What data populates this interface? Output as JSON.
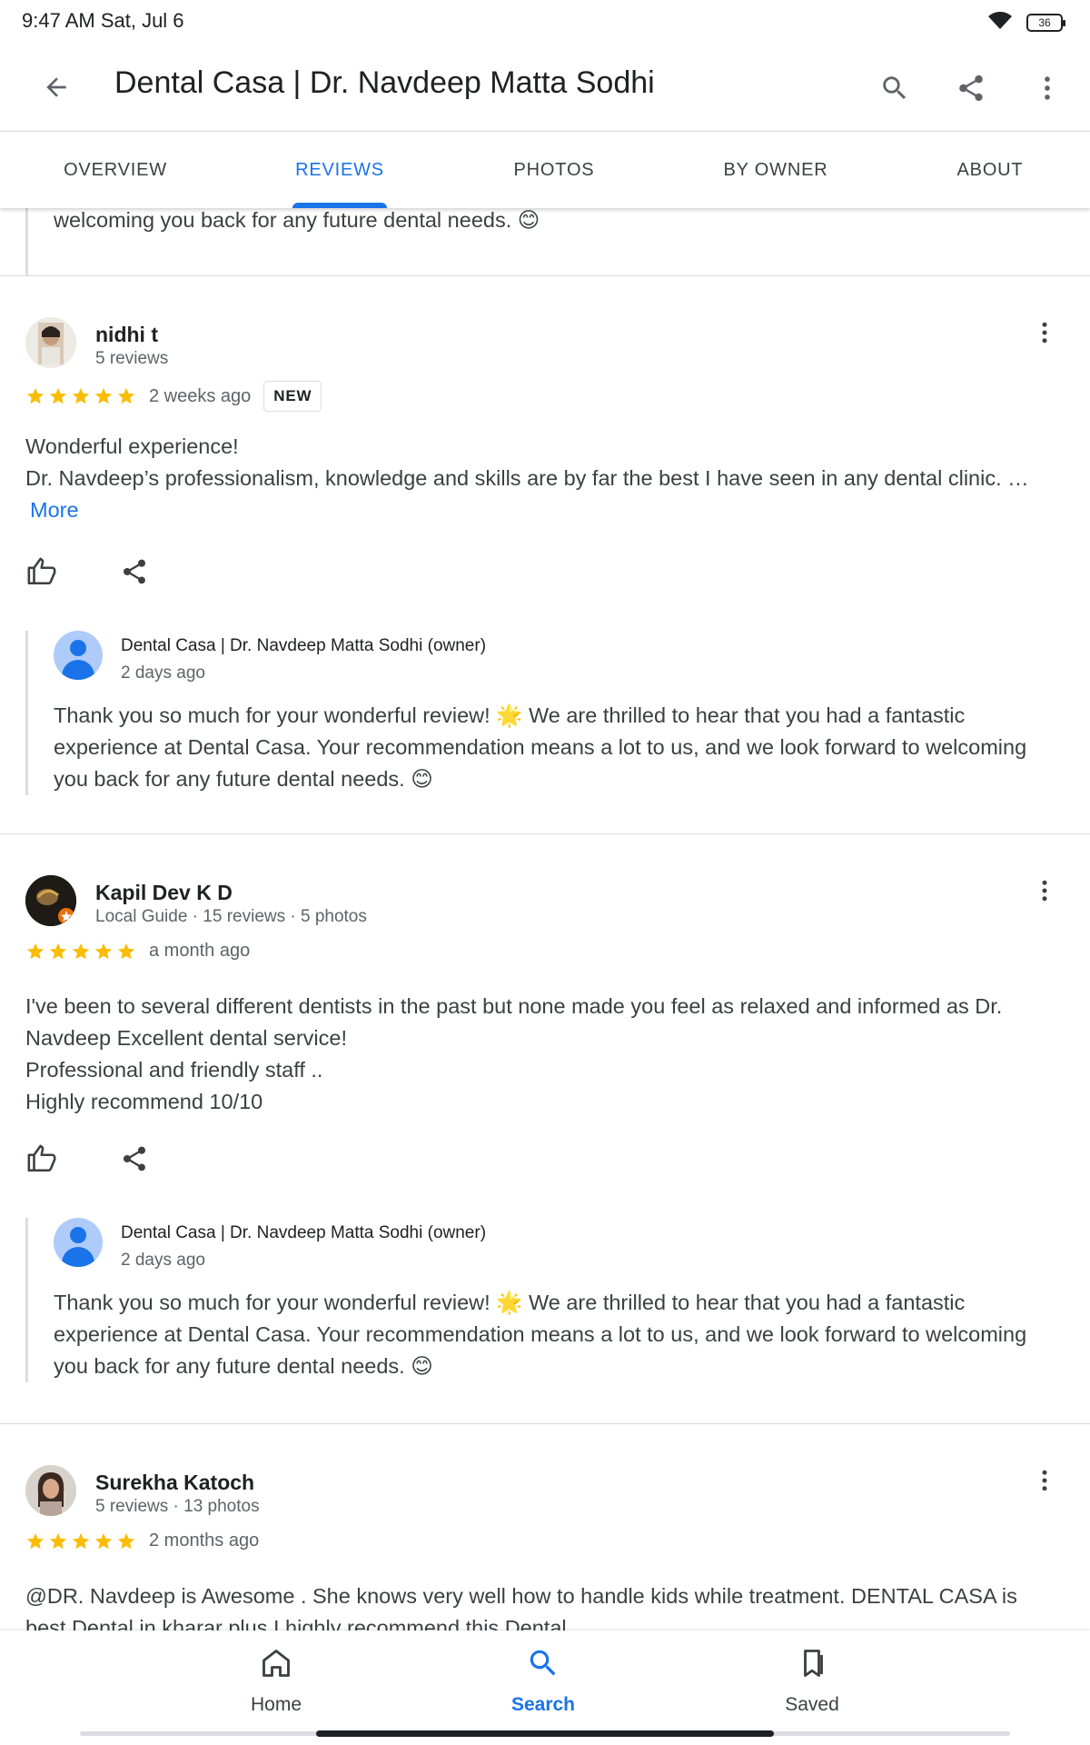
{
  "status_bar": {
    "time": "9:47 AM Sat, Jul 6",
    "battery": "36"
  },
  "app_bar": {
    "title": "Dental Casa | Dr. Navdeep Matta Sodhi"
  },
  "tabs": [
    {
      "label": "OVERVIEW"
    },
    {
      "label": "REVIEWS"
    },
    {
      "label": "PHOTOS"
    },
    {
      "label": "BY OWNER"
    },
    {
      "label": "ABOUT"
    }
  ],
  "active_tab": "REVIEWS",
  "partial_reply": {
    "text": "welcoming you back for any future dental needs. 😊"
  },
  "reviews": [
    {
      "name": "nidhi t",
      "meta": "5 reviews",
      "rating": 5,
      "time": "2 weeks ago",
      "badge": "NEW",
      "text_lines": [
        "Wonderful experience!",
        "Dr. Navdeep’s professionalism, knowledge and skills are by far the best I have seen in any dental clinic. …"
      ],
      "more_label": "More",
      "owner_reply": {
        "name": "Dental Casa | Dr. Navdeep Matta Sodhi (owner)",
        "time": "2 days ago",
        "text": "Thank you so much for your wonderful review! 🌟 We are thrilled to hear that you had a fantastic experience at Dental Casa. Your recommendation means a lot to us, and we look forward to welcoming you back for any future dental needs. 😊"
      }
    },
    {
      "name": "Kapil Dev K D",
      "meta": "Local Guide · 15 reviews · 5 photos",
      "rating": 5,
      "time": "a month ago",
      "text_lines": [
        "I've been to several different dentists in the past but none made you feel as relaxed and informed as Dr.",
        "Navdeep Excellent dental service!",
        "Professional and friendly staff ..",
        "Highly recommend 10/10"
      ],
      "owner_reply": {
        "name": "Dental Casa | Dr. Navdeep Matta Sodhi (owner)",
        "time": "2 days ago",
        "text": "Thank you so much for your wonderful review! 🌟 We are thrilled to hear that you had a fantastic experience at Dental Casa. Your recommendation means a lot to us, and we look forward to welcoming you back for any future dental needs. 😊"
      }
    },
    {
      "name": "Surekha Katoch",
      "meta": "5 reviews · 13 photos",
      "rating": 5,
      "time": "2 months ago",
      "text_lines": [
        "@DR. Navdeep is Awesome . She knows very well how to handle kids while treatment. DENTAL CASA is",
        "best Dental in kharar plus I highly recommend this Dental."
      ]
    }
  ],
  "bottom_nav": [
    {
      "label": "Home",
      "icon": "home-icon"
    },
    {
      "label": "Search",
      "icon": "search-icon"
    },
    {
      "label": "Saved",
      "icon": "saved-icon"
    }
  ],
  "active_nav": "Search",
  "colors": {
    "accent": "#1a73e8",
    "star": "#fbbc04",
    "text": "#202124",
    "secondary": "#5f6368",
    "divider": "#dadce0"
  }
}
